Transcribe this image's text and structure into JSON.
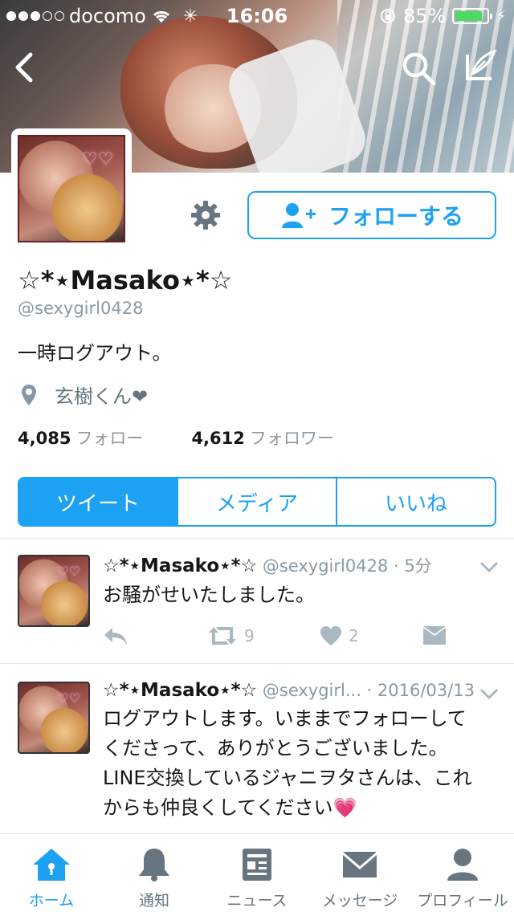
{
  "status_bar": {
    "carrier": "docomo",
    "time": "16:06",
    "battery_percent": "85%",
    "battery_level": 0.85,
    "signal_bars_filled": 3,
    "signal_bars_total": 5
  },
  "profile": {
    "name": "☆*⋆Masako⋆*☆",
    "handle": "@sexygirl0428",
    "bio": "一時ログアウト。",
    "location": "玄樹くん❤",
    "avatar_hearts": "♡♡",
    "following_count": "4,085",
    "following_label": "フォロー",
    "followers_count": "4,612",
    "followers_label": "フォロワー",
    "follow_button": "フォローする"
  },
  "profile_tabs": [
    {
      "label": "ツイート",
      "active": true
    },
    {
      "label": "メディア",
      "active": false
    },
    {
      "label": "いいね",
      "active": false
    }
  ],
  "tweets": [
    {
      "name": "☆*⋆Masako⋆*☆",
      "handle_time": "@sexygirl0428 · 5分",
      "text": "お騒がせいたしました。",
      "retweets": "9",
      "likes": "2"
    },
    {
      "name": "☆*⋆Masako⋆*☆",
      "handle_time": "@sexygirl... · 2016/03/13",
      "text": "ログアウトします。いままでフォローしてくださって、ありがとうございました。LINE交換しているジャニヲタさんは、これからも仲良くしてください💗",
      "retweets": "",
      "likes": ""
    }
  ],
  "tab_bar": [
    {
      "label": "ホーム",
      "icon": "home-icon",
      "active": true
    },
    {
      "label": "通知",
      "icon": "bell-icon",
      "active": false
    },
    {
      "label": "ニュース",
      "icon": "news-icon",
      "active": false
    },
    {
      "label": "メッセージ",
      "icon": "envelope-icon",
      "active": false
    },
    {
      "label": "プロフィール",
      "icon": "person-icon",
      "active": false
    }
  ],
  "colors": {
    "accent": "#1da1f2",
    "battery": "#4cd964",
    "muted": "#8899a6"
  }
}
